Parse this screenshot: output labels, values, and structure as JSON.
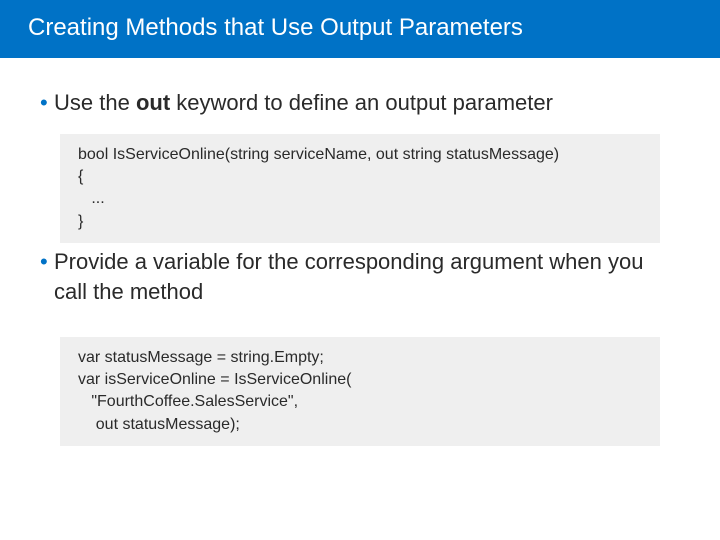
{
  "title": "Creating Methods that Use Output Parameters",
  "bullet1_pre": "Use the ",
  "bullet1_kw": "out",
  "bullet1_post": " keyword to define an output parameter",
  "code1": "bool IsServiceOnline(string serviceName, out string statusMessage)\n{\n   ...\n}",
  "bullet2": "Provide a variable for the corresponding argument when you call the method",
  "code2": "var statusMessage = string.Empty;\nvar isServiceOnline = IsServiceOnline(\n   \"FourthCoffee.SalesService\",\n    out statusMessage);"
}
